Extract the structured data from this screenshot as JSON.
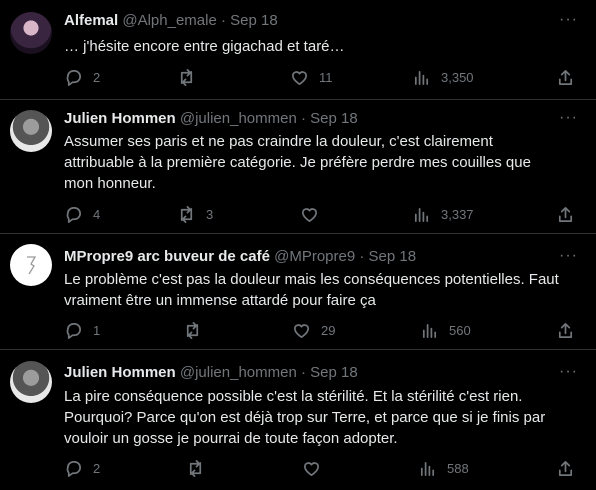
{
  "tweets": [
    {
      "name": "Alfemal",
      "handle": "@Alph_emale",
      "sep": "·",
      "date": "Sep 18",
      "text": "… j'hésite encore entre gigachad et taré…",
      "replies": "2",
      "retweets": "",
      "likes": "11",
      "views": "3,350"
    },
    {
      "name": "Julien Hommen",
      "handle": "@julien_hommen",
      "sep": "·",
      "date": "Sep 18",
      "text": "Assumer ses paris et ne pas craindre la douleur, c'est clairement attribuable à la première catégorie. Je préfère perdre mes couilles que mon honneur.",
      "replies": "4",
      "retweets": "3",
      "likes": "",
      "views": "3,337"
    },
    {
      "name": "MPropre9 arc buveur de café",
      "handle": "@MPropre9",
      "sep": "·",
      "date": "Sep 18",
      "text": "Le problème c'est pas la douleur mais les conséquences potentielles. Faut vraiment être un immense attardé pour faire ça",
      "replies": "1",
      "retweets": "",
      "likes": "29",
      "views": "560"
    },
    {
      "name": "Julien Hommen",
      "handle": "@julien_hommen",
      "sep": "·",
      "date": "Sep 18",
      "text": "La pire conséquence possible c'est la stérilité. Et la stérilité c'est rien. Pourquoi?  Parce qu'on est déjà trop sur Terre, et parce que si je finis par vouloir un gosse je pourrai de toute façon adopter.",
      "replies": "2",
      "retweets": "",
      "likes": "",
      "views": "588"
    }
  ],
  "more_glyph": "···"
}
